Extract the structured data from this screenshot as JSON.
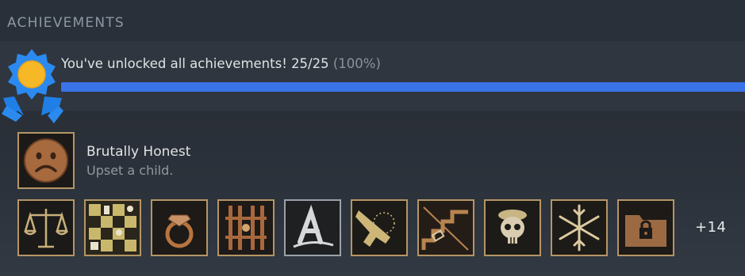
{
  "section": {
    "title": "ACHIEVEMENTS"
  },
  "summary": {
    "text": "You've unlocked all achievements! 25/25",
    "percent_text": "(100%)",
    "progress": 1.0,
    "colors": {
      "bar": "#3a72e8",
      "badge_blue": "#2b8af0",
      "badge_gold": "#f6b826"
    }
  },
  "featured": {
    "icon": "sad-face-icon",
    "title": "Brutally Honest",
    "description": "Upset a child."
  },
  "icons": [
    {
      "name": "scales-of-justice-icon"
    },
    {
      "name": "chessboard-icon"
    },
    {
      "name": "diamond-ring-icon"
    },
    {
      "name": "prison-bars-icon"
    },
    {
      "name": "letter-a-icon"
    },
    {
      "name": "pistol-icon"
    },
    {
      "name": "staircase-icon"
    },
    {
      "name": "skull-beret-icon"
    },
    {
      "name": "snowflake-icon"
    },
    {
      "name": "locked-folder-icon"
    }
  ],
  "more_label": "+14"
}
